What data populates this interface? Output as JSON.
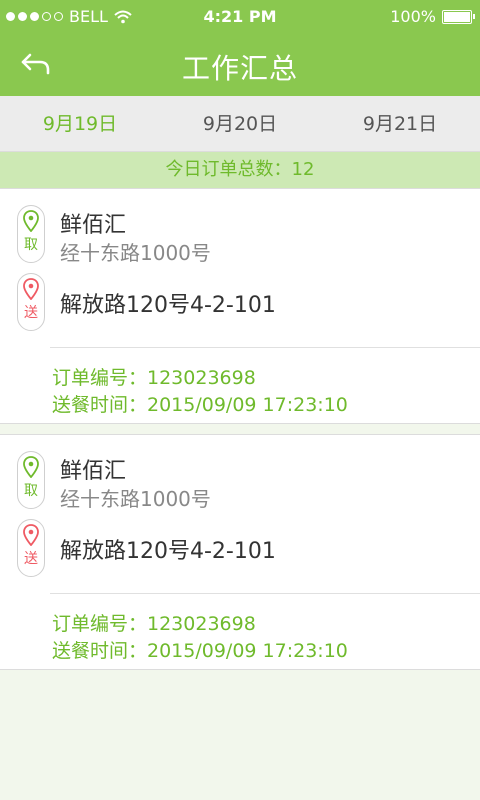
{
  "status": {
    "carrier": "BELL",
    "time": "4:21 PM",
    "battery": "100%",
    "battery_level": 1.0
  },
  "header": {
    "title": "工作汇总",
    "back_icon": "back-arrow-icon"
  },
  "date_tabs": [
    {
      "label": "9月19日",
      "active": true
    },
    {
      "label": "9月20日",
      "active": false
    },
    {
      "label": "9月21日",
      "active": false
    }
  ],
  "summary": {
    "text": "今日订单总数：12"
  },
  "orders": [
    {
      "pickup_badge": "取",
      "pickup_name": "鲜佰汇",
      "pickup_address": "经十东路1000号",
      "deliver_badge": "送",
      "deliver_address": "解放路120号4-2-101",
      "order_no": "订单编号：123023698",
      "delivery_time": "送餐时间：2015/09/09  17:23:10"
    },
    {
      "pickup_badge": "取",
      "pickup_name": "鲜佰汇",
      "pickup_address": "经十东路1000号",
      "deliver_badge": "送",
      "deliver_address": "解放路120号4-2-101",
      "order_no": "订单编号：123023698",
      "delivery_time": "送餐时间：2015/09/09  17:23:10"
    }
  ],
  "colors": {
    "brand_green": "#8ac84f",
    "accent_green": "#6fba2c",
    "deliver_red": "#ef5a63"
  }
}
